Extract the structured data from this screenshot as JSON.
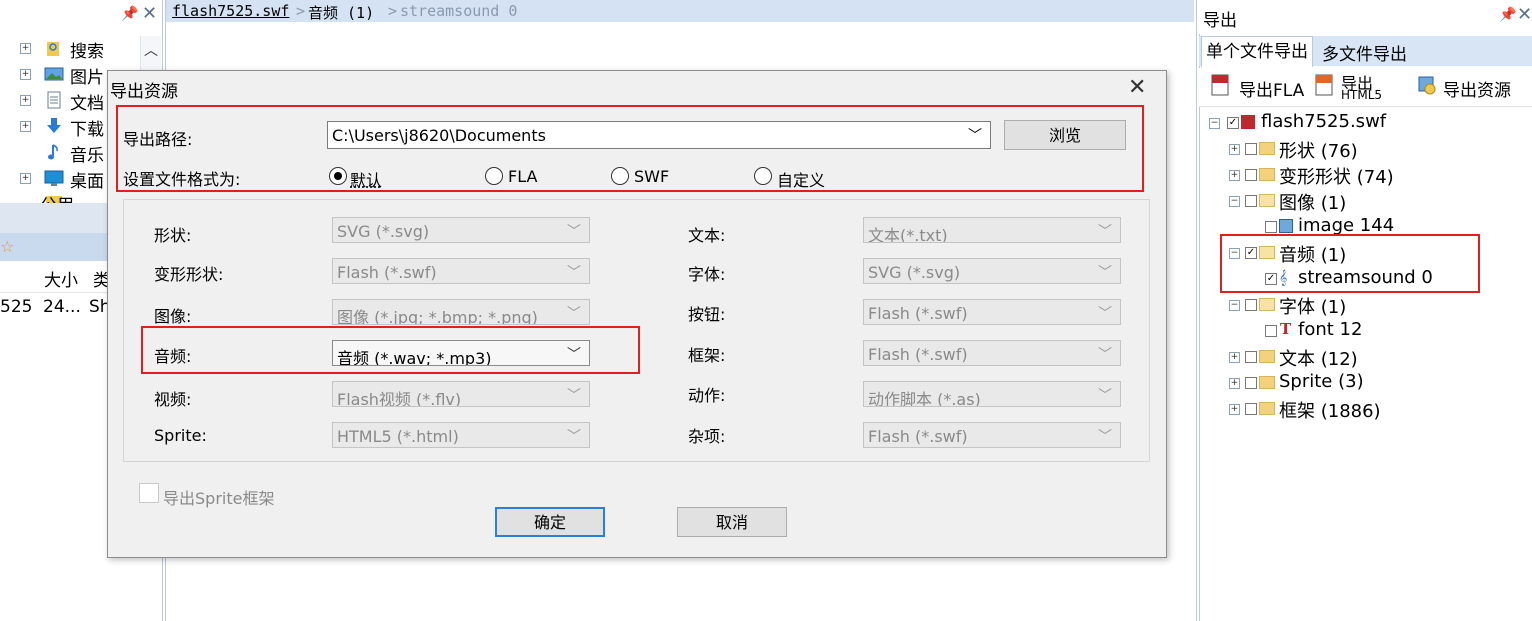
{
  "breadcrumb": {
    "items": [
      "flash7525.swf",
      "音频 (1)",
      "streamsound 0"
    ]
  },
  "left_panel": {
    "tree": [
      {
        "label": "搜索",
        "icon": "folder-search-icon"
      },
      {
        "label": "图片",
        "icon": "pictures-icon"
      },
      {
        "label": "文档",
        "icon": "documents-icon"
      },
      {
        "label": "下载",
        "icon": "download-icon"
      },
      {
        "label": "音乐",
        "icon": "music-icon"
      },
      {
        "label": "桌面",
        "icon": "desktop-icon"
      },
      {
        "label": "公用",
        "icon": "folder-icon"
      }
    ],
    "columns": [
      "大小",
      "类"
    ],
    "row": {
      "name": "525",
      "size": "24...",
      "type": "Sh"
    }
  },
  "right_panel": {
    "title": "导出",
    "tabs": [
      "单个文件导出",
      "多文件导出"
    ],
    "toolbar": [
      "导出FLA",
      "导出",
      "HTML5",
      "导出资源"
    ],
    "tree": {
      "root": "flash7525.swf",
      "items": [
        {
          "label": "形状 (76)"
        },
        {
          "label": "变形形状 (74)"
        },
        {
          "label": "图像 (1)"
        },
        {
          "label": "image 144"
        },
        {
          "label": "音频 (1)"
        },
        {
          "label": "streamsound 0"
        },
        {
          "label": "字体 (1)"
        },
        {
          "label": "font 12"
        },
        {
          "label": "文本 (12)"
        },
        {
          "label": "Sprite (3)"
        },
        {
          "label": "框架 (1886)"
        }
      ]
    }
  },
  "dialog": {
    "title": "导出资源",
    "path_label": "导出路径:",
    "path_value": "C:\\Users\\j8620\\Documents",
    "browse": "浏览",
    "format_label": "设置文件格式为:",
    "formats": [
      "默认",
      "FLA",
      "SWF",
      "自定义"
    ],
    "selected_format": "默认",
    "rows_left": [
      {
        "label": "形状:",
        "value": "SVG (*.svg)"
      },
      {
        "label": "变形形状:",
        "value": "Flash (*.swf)"
      },
      {
        "label": "图像:",
        "value": "图像 (*.jpg; *.bmp; *.png)"
      },
      {
        "label": "音频:",
        "value": "音频 (*.wav; *.mp3)"
      },
      {
        "label": "视频:",
        "value": "Flash视频 (*.flv)"
      },
      {
        "label": "Sprite:",
        "value": "HTML5 (*.html)"
      }
    ],
    "rows_right": [
      {
        "label": "文本:",
        "value": "文本(*.txt)"
      },
      {
        "label": "字体:",
        "value": "SVG (*.svg)"
      },
      {
        "label": "按钮:",
        "value": "Flash (*.swf)"
      },
      {
        "label": "框架:",
        "value": "Flash (*.swf)"
      },
      {
        "label": "动作:",
        "value": "动作脚本 (*.as)"
      },
      {
        "label": "杂项:",
        "value": "Flash (*.swf)"
      }
    ],
    "sprite_frames_label": "导出Sprite框架",
    "ok": "确定",
    "cancel": "取消"
  },
  "colors": {
    "highlight": "#e21f1f",
    "accent": "#2d7fd4",
    "panel": "#d8e5f4"
  }
}
